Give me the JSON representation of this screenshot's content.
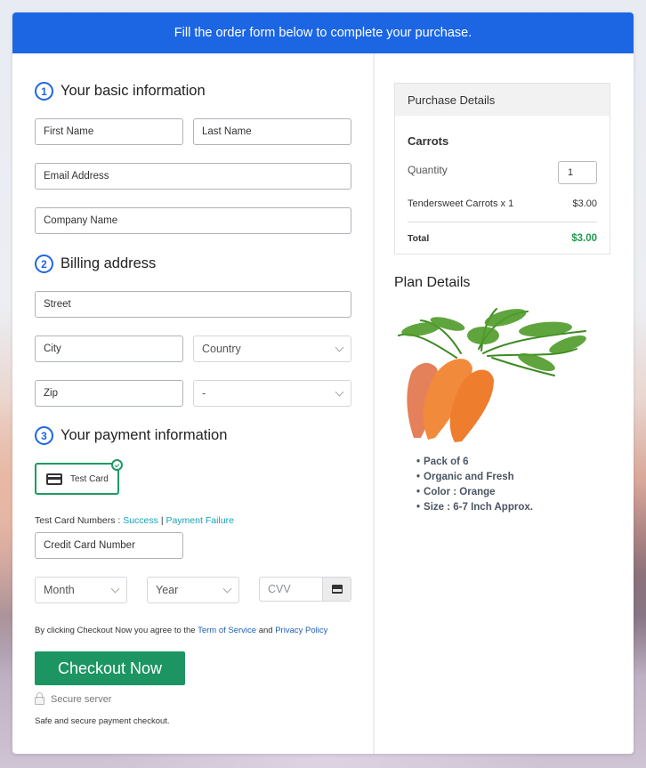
{
  "banner": {
    "text": "Fill the order form below to complete your purchase."
  },
  "sections": {
    "basic": {
      "number": "1",
      "title": "Your basic information"
    },
    "billing": {
      "number": "2",
      "title": "Billing address"
    },
    "payment": {
      "number": "3",
      "title": "Your payment information"
    }
  },
  "fields": {
    "first_name": "First Name",
    "last_name": "Last Name",
    "email": "Email Address",
    "company": "Company Name",
    "street": "Street",
    "city": "City",
    "country": "Country",
    "zip": "Zip",
    "state": "-",
    "card_number": "Credit Card Number",
    "month": "Month",
    "year": "Year",
    "cvv": "CVV"
  },
  "payment": {
    "method_label": "Test Card",
    "test_numbers_label": "Test Card Numbers :",
    "success_link": "Success",
    "separator": "|",
    "failure_link": "Payment Failure"
  },
  "agreement": {
    "prefix": "By clicking Checkout Now you agree to the",
    "terms_link": "Term of Service",
    "and": "and",
    "privacy_link": "Privacy Policy"
  },
  "checkout": {
    "button_label": "Checkout Now",
    "secure_label": "Secure server",
    "safe_text": "Safe and secure payment checkout."
  },
  "purchase": {
    "header": "Purchase Details",
    "product": "Carrots",
    "quantity_label": "Quantity",
    "quantity": "1",
    "line_item": "Tendersweet Carrots x 1",
    "line_price": "$3.00",
    "total_label": "Total",
    "total": "$3.00"
  },
  "plan": {
    "title": "Plan Details",
    "features": [
      "Pack of 6",
      "Organic and Fresh",
      "Color : Orange",
      "Size : 6-7 Inch Approx."
    ]
  },
  "colors": {
    "brand_blue": "#1c66e4",
    "checkout_green": "#1c9562",
    "total_green": "#1f9a4d",
    "link_teal": "#14a3b8"
  }
}
